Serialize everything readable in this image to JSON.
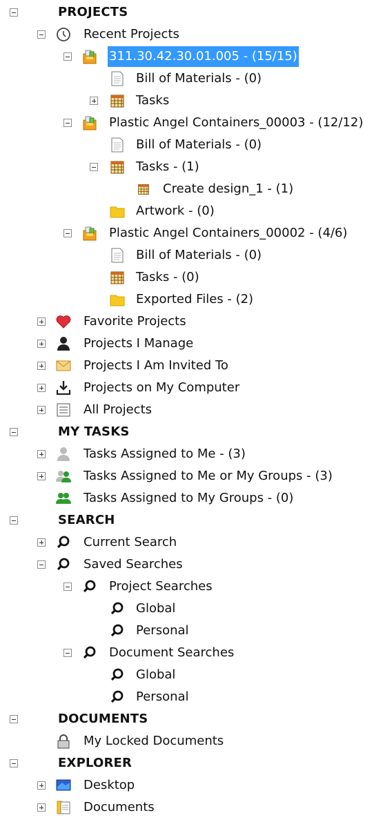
{
  "projects": {
    "header": "PROJECTS",
    "recent": {
      "label": "Recent Projects",
      "p1": {
        "label": "311.30.42.30.01.005 - (15/15)",
        "bom": "Bill of Materials - (0)",
        "tasks": "Tasks"
      },
      "p2": {
        "label": "Plastic Angel Containers_00003 - (12/12)",
        "bom": "Bill of Materials - (0)",
        "tasks": "Tasks - (1)",
        "task1": "Create design_1 - (1)",
        "artwork": "Artwork - (0)"
      },
      "p3": {
        "label": "Plastic Angel Containers_00002 - (4/6)",
        "bom": "Bill of Materials - (0)",
        "tasks": "Tasks - (0)",
        "exported": "Exported Files - (2)"
      }
    },
    "favorite": "Favorite Projects",
    "manage": "Projects I Manage",
    "invited": "Projects I Am Invited To",
    "computer": "Projects on My Computer",
    "all": "All Projects"
  },
  "my_tasks": {
    "header": "MY TASKS",
    "assigned_me": "Tasks Assigned to Me - (3)",
    "assigned_me_groups": "Tasks Assigned to Me or My Groups - (3)",
    "assigned_groups": "Tasks Assigned to My Groups - (0)"
  },
  "search": {
    "header": "SEARCH",
    "current": "Current Search",
    "saved": "Saved Searches",
    "project_searches": "Project Searches",
    "ps_global": "Global",
    "ps_personal": "Personal",
    "document_searches": "Document Searches",
    "ds_global": "Global",
    "ds_personal": "Personal"
  },
  "documents": {
    "header": "DOCUMENTS",
    "locked": "My Locked Documents"
  },
  "explorer": {
    "header": "EXPLORER",
    "desktop": "Desktop",
    "documents": "Documents"
  },
  "colors": {
    "selection": "#3399ff",
    "folder": "#f7c81e",
    "heart": "#e0303a",
    "group_green": "#2e9b2e"
  }
}
